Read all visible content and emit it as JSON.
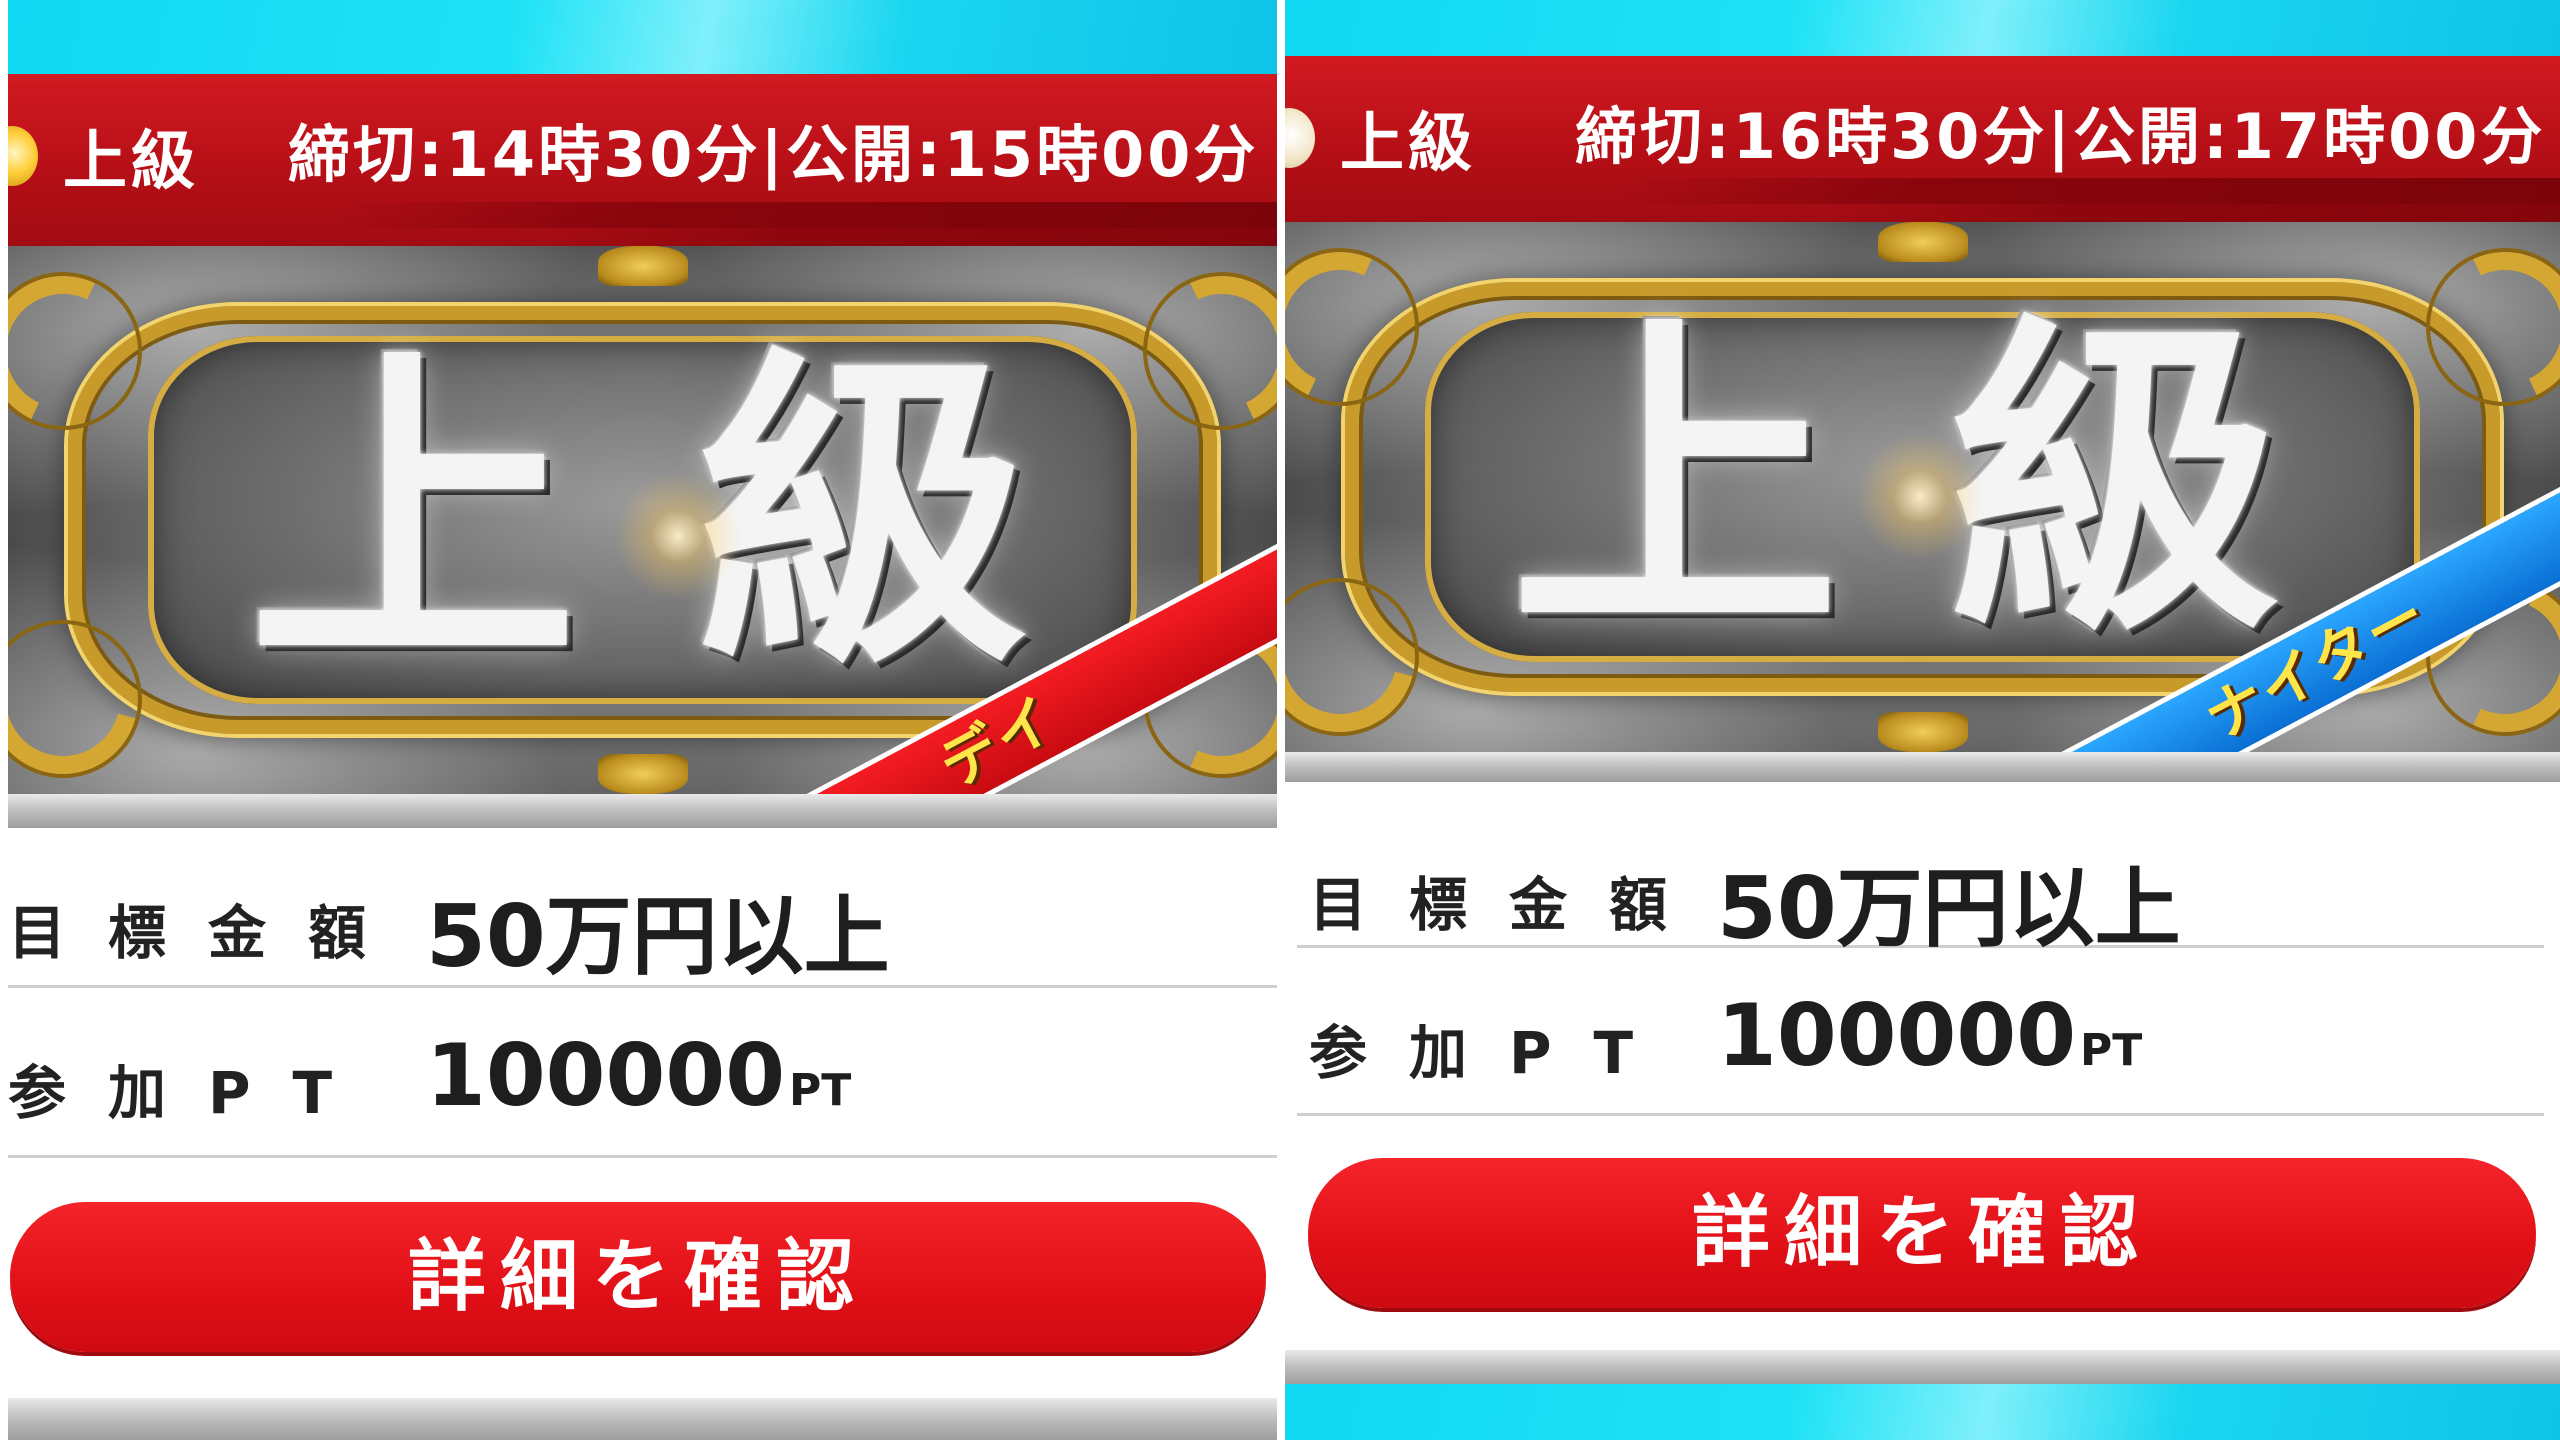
{
  "panels": [
    {
      "header": {
        "tag": "上級",
        "schedule": "締切:14時30分|公開:15時00分"
      },
      "banner": {
        "title_char_1": "上",
        "title_char_2": "級",
        "ribbon_label": "デイ",
        "ribbon_color": "#e10f16"
      },
      "rows": [
        {
          "label": "目標金額",
          "value": "50万円以上",
          "unit": ""
        },
        {
          "label": "参加PT",
          "value": "100000",
          "unit": "PT"
        }
      ],
      "button_label": "詳細を確認"
    },
    {
      "header": {
        "tag": "上級",
        "schedule": "締切:16時30分|公開:17時00分"
      },
      "banner": {
        "title_char_1": "上",
        "title_char_2": "級",
        "ribbon_label": "ナイター",
        "ribbon_color": "#1a8ee8"
      },
      "rows": [
        {
          "label": "目標金額",
          "value": "50万円以上",
          "unit": ""
        },
        {
          "label": "参加PT",
          "value": "100000",
          "unit": "PT"
        }
      ],
      "button_label": "詳細を確認"
    }
  ],
  "icons": [
    "gold-gem-icon",
    "cream-gem-icon"
  ],
  "colors": {
    "header_red": "#b70f17",
    "button_red": "#e10f16",
    "sky_cyan": "#1fe2f6",
    "ornament_gold": "#d4a732"
  }
}
